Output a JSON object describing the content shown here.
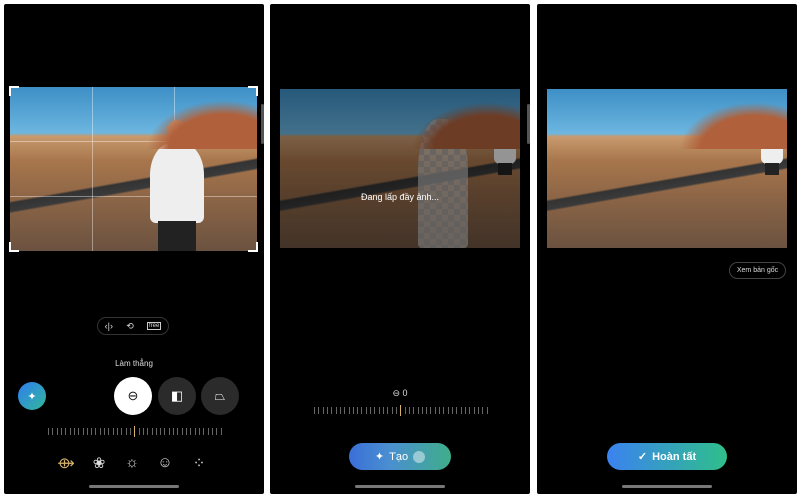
{
  "panel1": {
    "aspect_tools": [
      {
        "icon": "flip-icon",
        "glyph": "‹|›"
      },
      {
        "icon": "rotate-icon",
        "glyph": "⟲"
      },
      {
        "icon": "free-aspect-icon",
        "glyph": "free"
      }
    ],
    "mode_label": "Làm thẳng",
    "ai_button_icon": "sparkle-icon",
    "modes": [
      {
        "icon": "straighten-icon",
        "glyph": "⊖",
        "active": true
      },
      {
        "icon": "vertical-perspective-icon",
        "glyph": "◧",
        "active": false
      },
      {
        "icon": "horizontal-perspective-icon",
        "glyph": "⏢",
        "active": false
      }
    ],
    "bottom_tools": [
      {
        "icon": "crop-rotate-icon",
        "glyph": "⟴",
        "active": true
      },
      {
        "icon": "filters-icon",
        "glyph": "❀"
      },
      {
        "icon": "brightness-icon",
        "glyph": "☼"
      },
      {
        "icon": "sticker-icon",
        "glyph": "☺"
      },
      {
        "icon": "more-icon",
        "glyph": "⁘"
      }
    ],
    "accent": "#d6b46a"
  },
  "panel2": {
    "status": "Đang lấp đầy ảnh...",
    "angle_value": "0",
    "generate_label": "Tạo"
  },
  "panel3": {
    "view_original_label": "Xem bản gốc",
    "done_label": "Hoàn tất",
    "gradient": [
      "#3b82f0",
      "#2fbf8a"
    ]
  }
}
